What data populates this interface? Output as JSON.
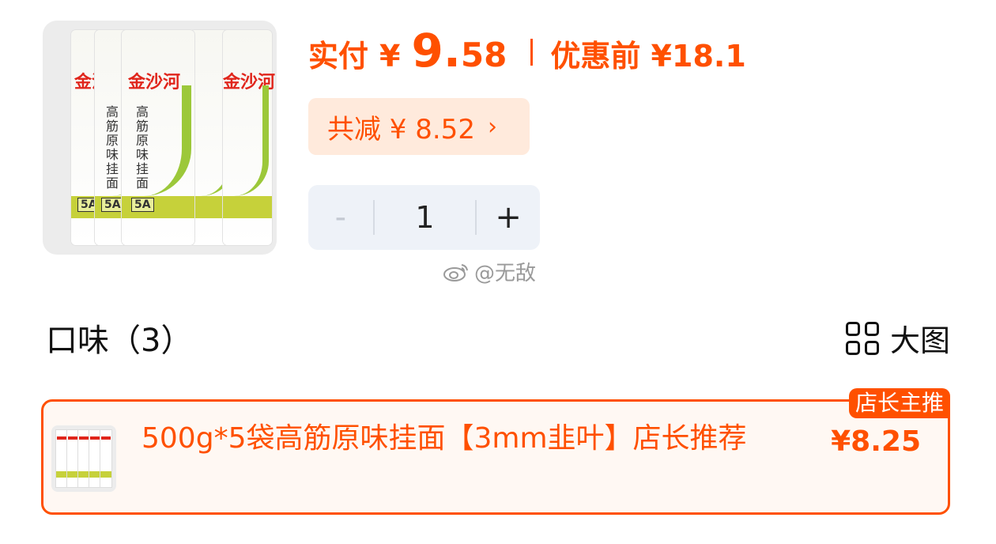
{
  "product": {
    "image_brand": "金沙河",
    "image_name": "高筋原味挂面",
    "image_grade": "5A"
  },
  "price": {
    "pay_label": "实付",
    "currency": "¥",
    "pay_integer": "9",
    "pay_dot": ".",
    "pay_decimal": "58",
    "original": "优惠前 ¥18.1",
    "discount": "共减 ¥ 8.52",
    "discount_chevron": "›"
  },
  "quantity": {
    "minus": "-",
    "value": "1",
    "plus": "+"
  },
  "watermark": "@无敌",
  "flavor_section": {
    "title": "口味（3）",
    "big_view_label": "大图"
  },
  "options": [
    {
      "name": "500g*5袋高筋原味挂面【3mm韭叶】店长推荐",
      "price": "¥8.25",
      "tag": "店长主推"
    }
  ],
  "colors": {
    "accent": "#ff5000",
    "discount_bg": "#ffeadc",
    "stepper_bg": "#eef2f8"
  },
  "icons": {
    "grid": "grid-icon",
    "watermark_logo": "weibo-icon",
    "chevron": "chevron-right-icon"
  }
}
